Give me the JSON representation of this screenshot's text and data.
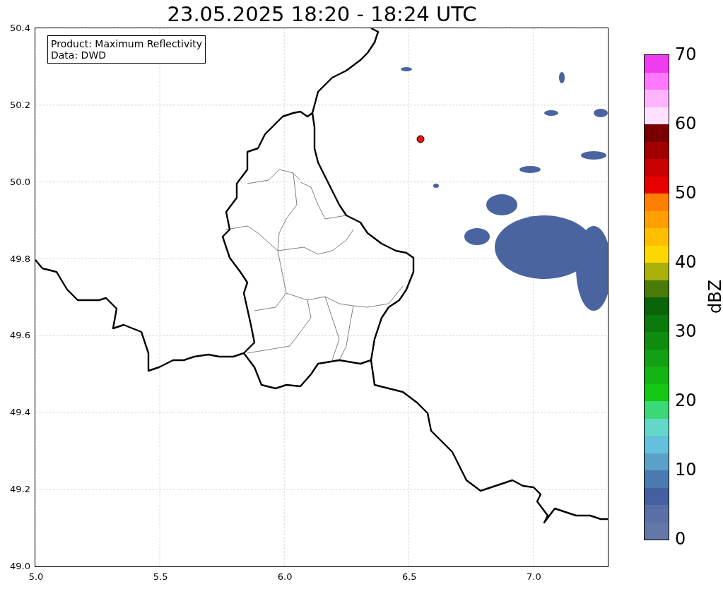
{
  "title": "23.05.2025 18:20 - 18:24 UTC",
  "map": {
    "legend": [
      "Product: Maximum Reflectivity",
      "Data: DWD"
    ],
    "yticks": [
      "50.4",
      "50.2",
      "50.0",
      "49.8",
      "49.6",
      "49.4",
      "49.2",
      "49.0"
    ],
    "xticks": [
      "5.0",
      "5.5",
      "6.0",
      "6.5",
      "7.0"
    ]
  },
  "colorbar": {
    "label": "dBZ",
    "ticks": [
      "70",
      "60",
      "50",
      "40",
      "30",
      "20",
      "10",
      "0"
    ],
    "segments": [
      {
        "color": "#f03cf0"
      },
      {
        "color": "#ff78ff"
      },
      {
        "color": "#ffb4ff"
      },
      {
        "color": "#ffe0ff"
      },
      {
        "color": "#780000"
      },
      {
        "color": "#a00000"
      },
      {
        "color": "#c80000"
      },
      {
        "color": "#e60000"
      },
      {
        "color": "#ff8000"
      },
      {
        "color": "#ffa000"
      },
      {
        "color": "#ffbe00"
      },
      {
        "color": "#ffd700"
      },
      {
        "color": "#aab00a"
      },
      {
        "color": "#4a7a0a"
      },
      {
        "color": "#0a640a"
      },
      {
        "color": "#0a780a"
      },
      {
        "color": "#0f8c0f"
      },
      {
        "color": "#14a014"
      },
      {
        "color": "#14b414"
      },
      {
        "color": "#14c814"
      },
      {
        "color": "#3cd878"
      },
      {
        "color": "#64d8c8"
      },
      {
        "color": "#64c0dc"
      },
      {
        "color": "#5aa0c8"
      },
      {
        "color": "#4a7ab0"
      },
      {
        "color": "#4560a0"
      },
      {
        "color": "#5a6fa5"
      },
      {
        "color": "#6478a8"
      }
    ]
  }
}
